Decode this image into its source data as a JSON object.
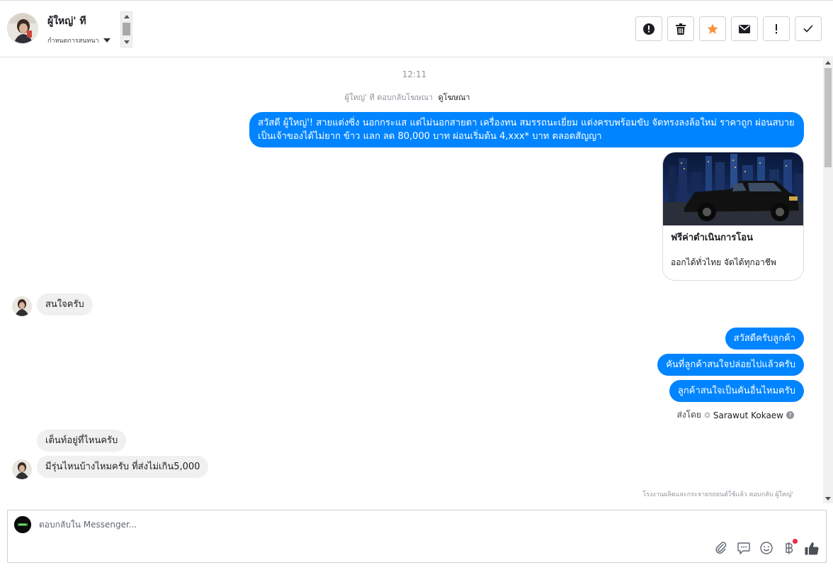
{
  "header": {
    "contact_name": "ผู้ใหญ่' ที",
    "conversation_status": "กำหนดการสนทนา",
    "actions": [
      {
        "name": "mark-spam",
        "icon": "exclamation-circle-icon"
      },
      {
        "name": "delete",
        "icon": "trash-icon"
      },
      {
        "name": "star",
        "icon": "star-icon"
      },
      {
        "name": "mark-unread",
        "icon": "envelope-icon"
      },
      {
        "name": "follow-up",
        "icon": "exclamation-icon"
      },
      {
        "name": "done",
        "icon": "check-icon"
      }
    ]
  },
  "conversation": {
    "timestamp": "12:11",
    "reply_note_prefix": "ผู้ใหญ่' ที ตอบกลับโฆษณา",
    "reply_note_link": "ดูโฆษณา",
    "ad_message": "สวัสดี ผู้ใหญ่'! สายแต่งซิ่ง นอกกระแส แต่ไม่นอกสายตา เครื่องทน สมรรถนะเยี่ยม แต่งครบพร้อมขับ จัดทรงลงล้อใหม่ ราคาถูก ผ่อนสบาย เป็นเจ้าของได้ไม่ยาก ข้าว แลก ลด 80,000 บาท ผ่อนเริ่มต้น 4,xxx* บาท ตลอดสัญญา",
    "ad_card": {
      "title": "ฟรีค่าดำเนินการโอน",
      "description": "ออกได้ทั่วไทย จัดได้ทุกอาชีพ"
    },
    "customer_message_1": "สนใจครับ",
    "agent_messages": [
      "สวัสดีครับลูกค้า",
      "คันที่ลูกค้าสนใจปล่อยไปแล้วครับ",
      "ลูกค้าสนใจเป็นคันอื่นไหมครับ"
    ],
    "sent_by_label": "ส่งโดย",
    "sent_by_name": "Sarawut Kokaew",
    "customer_message_2": "เต็นท์อยู่ที่ไหนครับ",
    "customer_message_3": "มีรุ่นไหนบ้างไหมครับ ที่ส่งไม่เกิน5,000",
    "footnote": "โรงงานผลิตและกระจายรถยนต์ใช้แล้ว ตอบกลับ ผู้ใหญ่'"
  },
  "composer": {
    "placeholder": "ตอบกลับใน Messenger...",
    "tools": [
      "paperclip-icon",
      "chat-bubble-icon",
      "smiley-icon",
      "baht-icon",
      "thumbs-up-icon"
    ]
  },
  "colors": {
    "accent": "#0084ff",
    "incoming_bubble": "#f1f0f0",
    "star": "#f7923b",
    "badge": "#f02849"
  }
}
